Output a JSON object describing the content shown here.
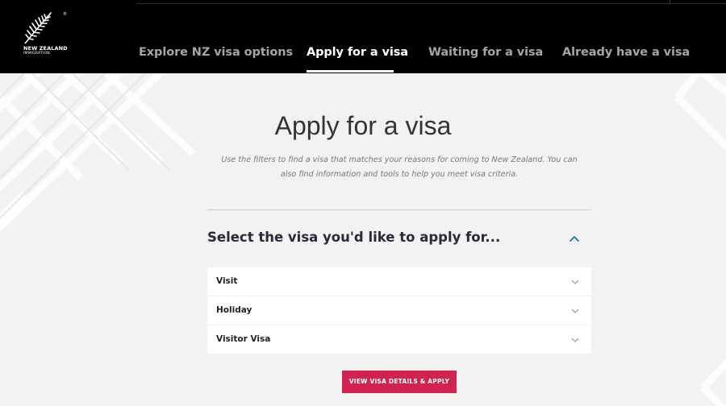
{
  "header": {
    "logo": {
      "line1": "NEW ZEALAND",
      "line2": "IMMIGRATION",
      "mark": "®",
      "icon": "silver-fern-icon"
    },
    "nav": [
      {
        "label": "Explore NZ visa options",
        "active": false
      },
      {
        "label": "Apply for a visa",
        "active": true
      },
      {
        "label": "Waiting for a visa",
        "active": false
      },
      {
        "label": "Already have a visa",
        "active": false
      }
    ]
  },
  "main": {
    "title": "Apply for a visa",
    "intro": "Use the filters to find a visa that matches your reasons for coming to New Zealand. You can also find information and tools to help you meet visa criteria.",
    "select_heading": "Select the visa you'd like to apply for...",
    "collapse_icon": "chevron-up-icon",
    "dropdowns": [
      {
        "label": "Visit",
        "icon": "chevron-down-icon"
      },
      {
        "label": "Holiday",
        "icon": "chevron-down-icon"
      },
      {
        "label": "Visitor Visa",
        "icon": "chevron-down-icon"
      }
    ],
    "cta_label": "VIEW VISA DETAILS & APPLY"
  },
  "colors": {
    "header_bg": "#000000",
    "page_bg": "#f2f2f2",
    "accent": "#d1234f",
    "link_blue": "#1a73a8"
  }
}
